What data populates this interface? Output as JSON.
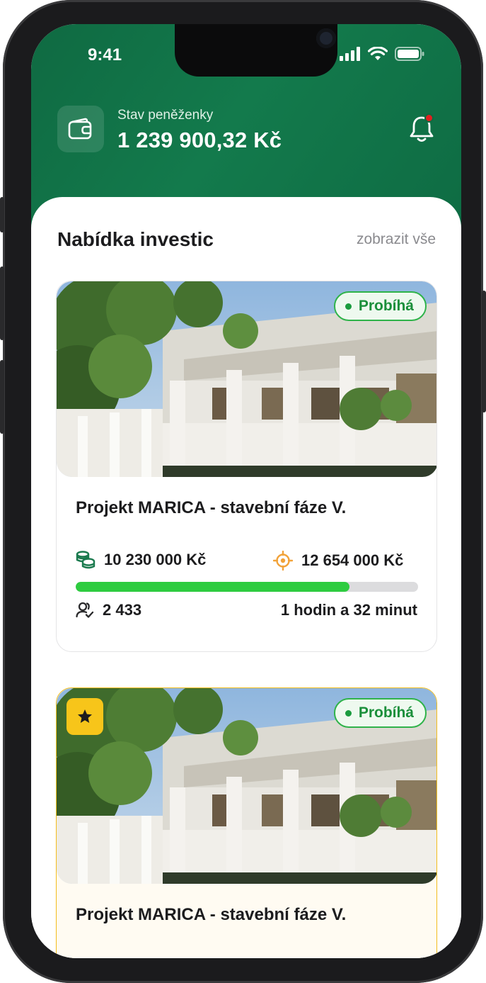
{
  "status_bar": {
    "time": "9:41"
  },
  "wallet": {
    "label": "Stav peněženky",
    "value": "1 239 900,32 Kč"
  },
  "section": {
    "title": "Nabídka investic",
    "show_all": "zobrazit vše"
  },
  "cards": [
    {
      "status": "Probíhá",
      "title": "Projekt MARICA - stavební fáze V.",
      "raised": "10 230 000 Kč",
      "target": "12 654 000 Kč",
      "progress_percent": 80,
      "investors": "2 433",
      "time_left": "1 hodin a 32 minut",
      "featured": false
    },
    {
      "status": "Probíhá",
      "title": "Projekt MARICA - stavební fáze V.",
      "featured": true
    }
  ],
  "colors": {
    "header_green": "#0f6a42",
    "progress_green": "#2ecc40",
    "badge_green": "#1a8f3a",
    "featured_yellow": "#f7c51a"
  }
}
